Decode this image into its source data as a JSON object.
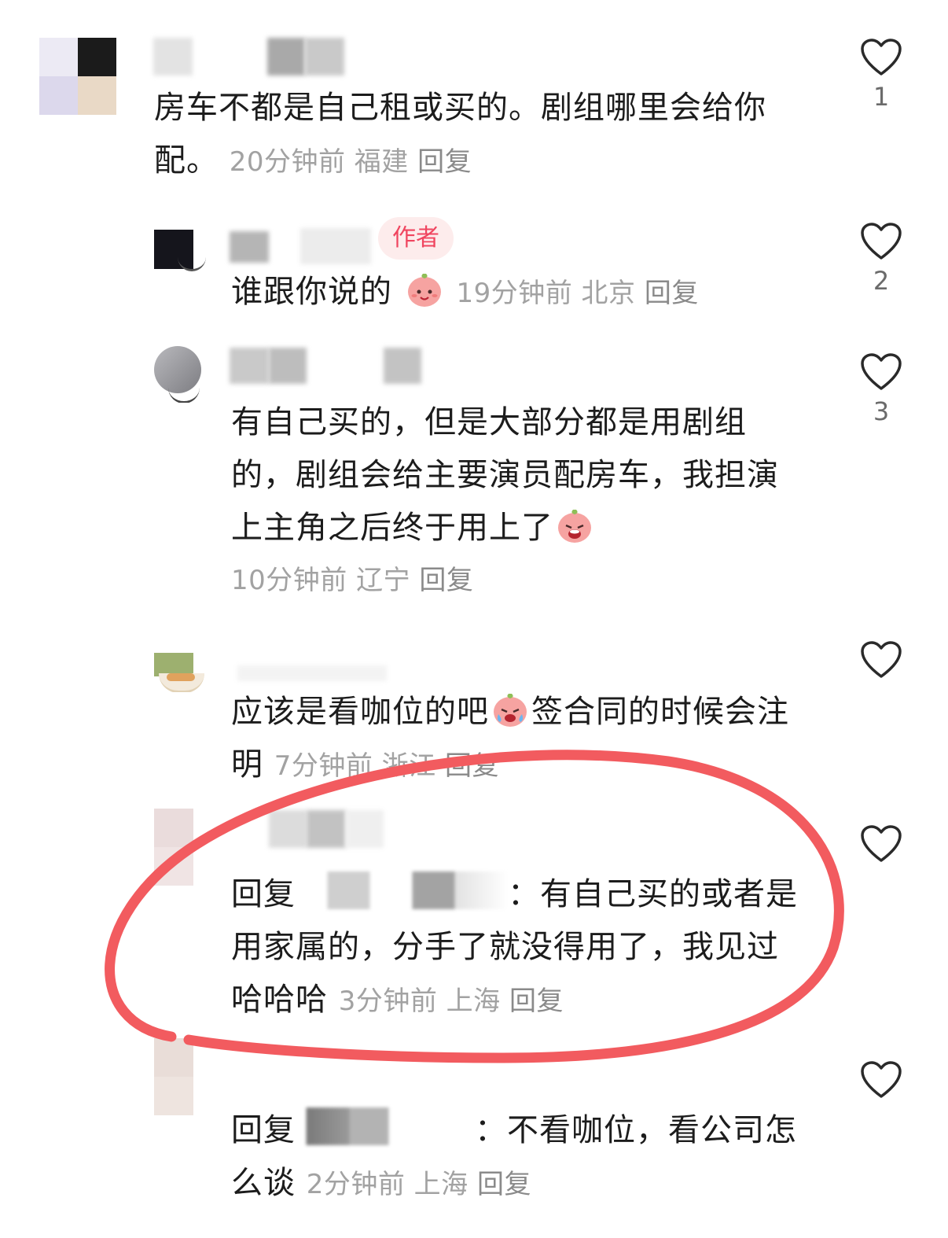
{
  "comments": [
    {
      "text": "房车不都是自己租或买的。剧组哪里会给你配。",
      "line1": "房车不都是自己租或买的。剧组哪里会给你",
      "line2": "配。",
      "time": "20分钟前",
      "location": "福建",
      "reply": "回复",
      "likes": "1"
    },
    {
      "badge": "作者",
      "text": "谁跟你说的",
      "emoji": "baby-face-emoji",
      "time": "19分钟前",
      "location": "北京",
      "reply": "回复",
      "likes": "2"
    },
    {
      "line1": "有自己买的，但是大部分都是用剧组",
      "line2": "的，剧组会给主要演员配房车，我担演",
      "line3": "上主角之后终于用上了",
      "emoji": "crying-face-emoji",
      "time": "10分钟前",
      "location": "辽宁",
      "reply": "回复",
      "likes": "3"
    },
    {
      "line1a": "应该是看咖位的吧",
      "line1b": "签合同的时候会注",
      "line2": "明",
      "emoji": "crying-face-emoji",
      "time": "7分钟前",
      "location": "浙江",
      "reply": "回复",
      "likes": ""
    },
    {
      "prefix": "回复",
      "line1": "：有自己买的或者是",
      "line2": "用家属的，分手了就没得用了，我见过",
      "line3": "哈哈哈",
      "time": "3分钟前",
      "location": "上海",
      "reply": "回复",
      "likes": ""
    },
    {
      "prefix": "回复",
      "line1": "：不看咖位，看公司怎",
      "line2": "么谈",
      "time": "2分钟前",
      "location": "上海",
      "reply": "回复",
      "likes": ""
    }
  ],
  "colors": {
    "highlight_circle": "#f25b5f",
    "badge_text": "#f0455f",
    "badge_bg": "#fdecec",
    "meta_text": "#a2a2a2"
  }
}
